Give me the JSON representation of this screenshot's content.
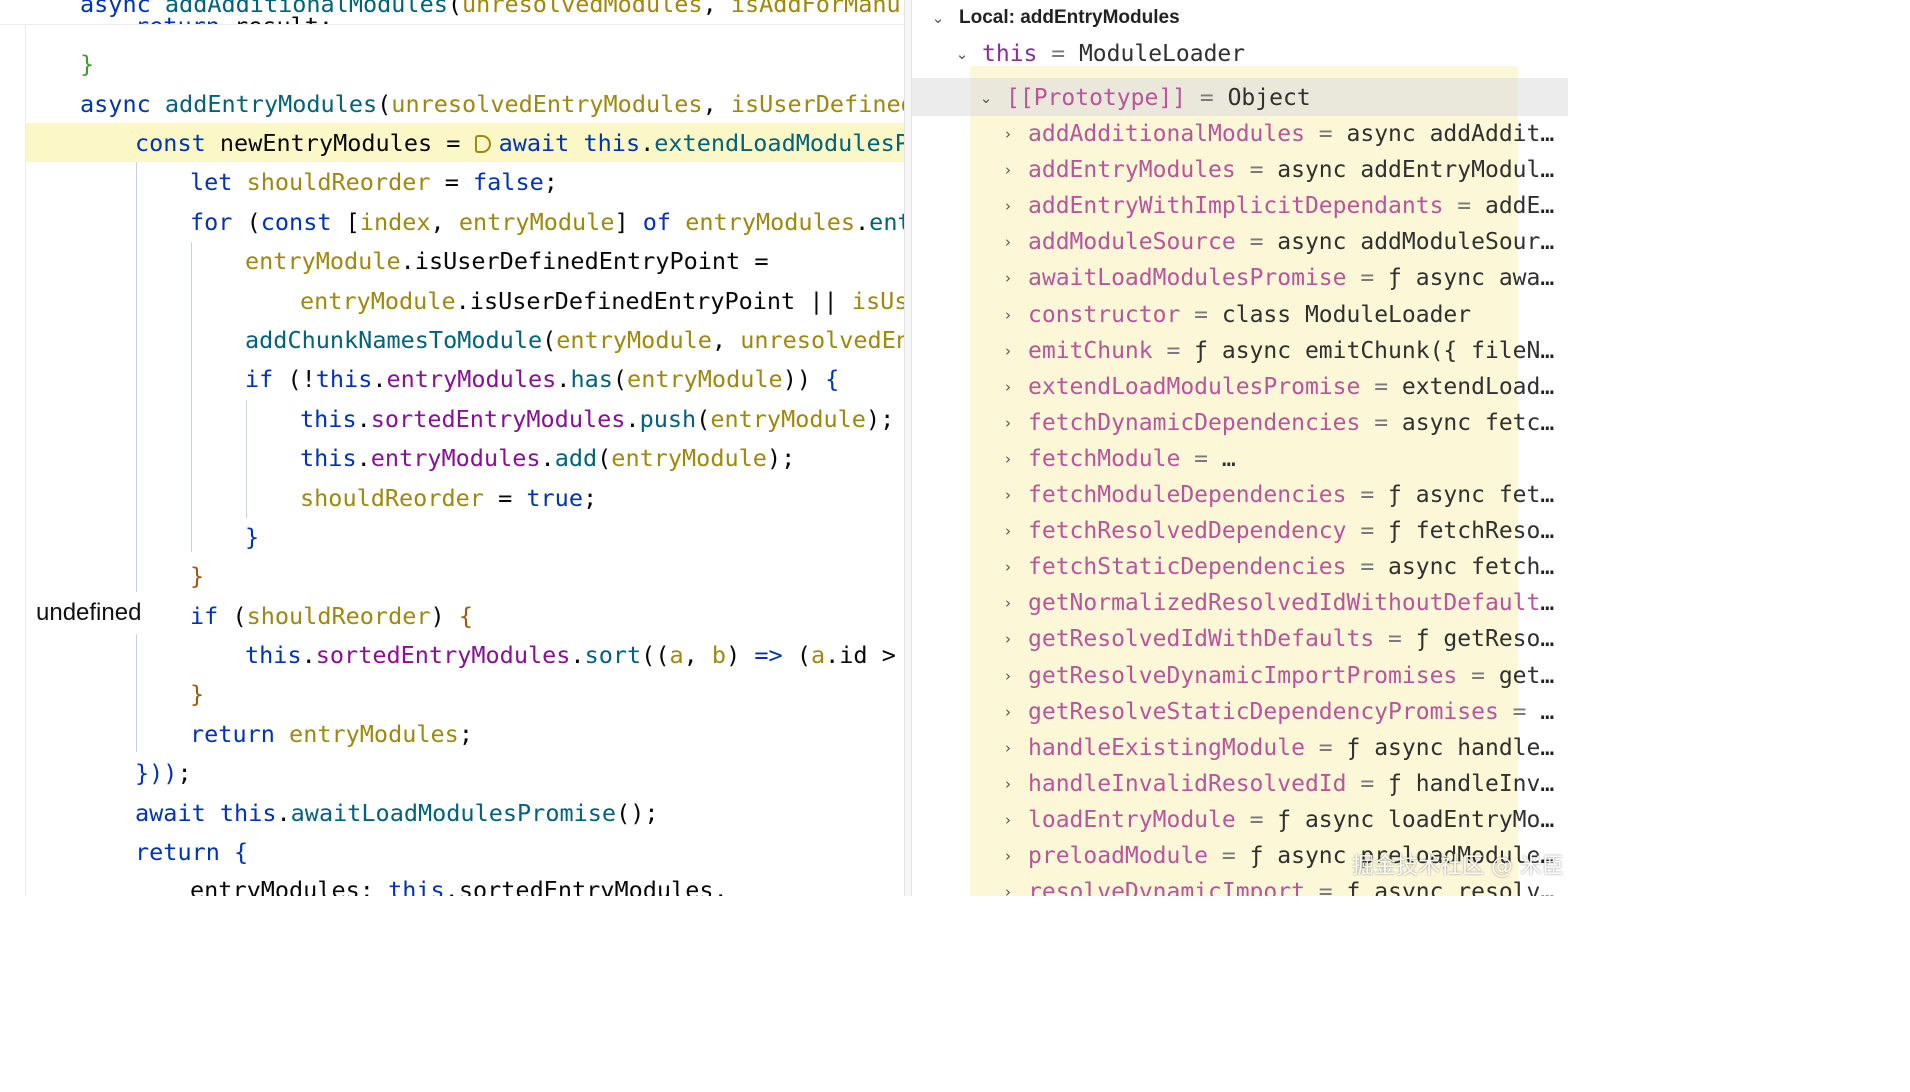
{
  "editor": {
    "code_lines": [
      "async addAdditionalModules(unresolvedModules, isAddForManu",
      "return result;",
      "}",
      "async addEntryModules(unresolvedEntryModules, isUserDefined)",
      "const newEntryModules = await this.extendLoadModulesPr",
      "let shouldReorder = false;",
      "for (const [index, entryModule] of entryModules.entr",
      "entryModule.isUserDefinedEntryPoint =",
      "entryModule.isUserDefinedEntryPoint || isUse",
      "addChunkNamesToModule(entryModule, unresolvedEnt",
      "if (!this.entryModules.has(entryModule)) {",
      "this.sortedEntryModules.push(entryModule);",
      "this.entryModules.add(entryModule);",
      "shouldReorder = true;",
      "}",
      "}",
      "if (shouldReorder) {",
      "this.sortedEntryModules.sort((a, b) => (a.id > b",
      "}",
      "return entryModules;",
      "}));",
      "await this.awaitLoadModulesPromise();",
      "return {",
      "entryModules: this.sortedEntryModules,"
    ],
    "hover_tooltip": "undefined"
  },
  "debugger": {
    "scope_title": "Local: addEntryModules",
    "this_row": {
      "name": "this",
      "value": "ModuleLoader"
    },
    "prototype_row": {
      "name": "[[Prototype]]",
      "value": "Object"
    },
    "properties": [
      {
        "name": "addAdditionalModules",
        "value": "async addAdditiona…"
      },
      {
        "name": "addEntryModules",
        "value": "async addEntryModules(u…"
      },
      {
        "name": "addEntryWithImplicitDependants",
        "value": "addEntry…"
      },
      {
        "name": "addModuleSource",
        "value": "async addModuleSource(i…"
      },
      {
        "name": "awaitLoadModulesPromise",
        "value": "ƒ async awaitLo…"
      },
      {
        "name": "constructor",
        "value": "class ModuleLoader"
      },
      {
        "name": "emitChunk",
        "value": "ƒ async emitChunk({ fileName,…"
      },
      {
        "name": "extendLoadModulesPromise",
        "value": "extendLoadModu…"
      },
      {
        "name": "fetchDynamicDependencies",
        "value": "async fetchDyn…"
      },
      {
        "name": "fetchModule",
        "value": "…"
      },
      {
        "name": "fetchModuleDependencies",
        "value": "ƒ async fetchMo…"
      },
      {
        "name": "fetchResolvedDependency",
        "value": "ƒ fetchResolved…"
      },
      {
        "name": "fetchStaticDependencies",
        "value": "async fetchStat…"
      },
      {
        "name": "getNormalizedResolvedIdWithoutDefaults",
        "value": "ƒ…"
      },
      {
        "name": "getResolvedIdWithDefaults",
        "value": "ƒ getResolved…"
      },
      {
        "name": "getResolveDynamicImportPromises",
        "value": "getReso…"
      },
      {
        "name": "getResolveStaticDependencyPromises",
        "value": "getR…"
      },
      {
        "name": "handleExistingModule",
        "value": "ƒ async handleExis…"
      },
      {
        "name": "handleInvalidResolvedId",
        "value": "ƒ handleInvalid…"
      },
      {
        "name": "loadEntryModule",
        "value": "ƒ async loadEntryModule…"
      },
      {
        "name": "preloadModule",
        "value": "ƒ async preloadModule(res…"
      },
      {
        "name": "resolveDynamicImport",
        "value": "ƒ async resolveDyn…"
      }
    ]
  },
  "watermark": "掘金技术社区 @ 米臣",
  "colors": {
    "keyword": "#0033b3",
    "function": "#00627a",
    "member": "#871094",
    "parameter": "#9e880d",
    "literal": "#1750eb",
    "current_line": "#fbf7c6",
    "property_name": "#b8559d",
    "highlight_overlay": "#fbf6d4"
  }
}
